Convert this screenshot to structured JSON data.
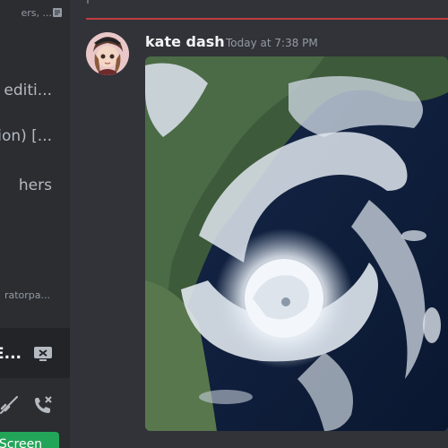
{
  "sidebar": {
    "top_subtext": "ers, ...",
    "doc_icon": "doc-icon",
    "items": [
      {
        "label": "editi..."
      },
      {
        "label": "ion) [..."
      },
      {
        "label": "hers"
      },
      {
        "label": "ratorpa..."
      }
    ],
    "voice_panel": {
      "label": "E...",
      "screen_icon": "screen-share-icon"
    },
    "controls": {
      "mute_icon": "mic-muted-icon",
      "call_icon": "disconnect-call-icon"
    },
    "screen_button": "Screen"
  },
  "message": {
    "username": "kate dash",
    "timestamp": "Today at 7:38 PM",
    "attachment": "hurricane-satellite-image"
  },
  "colors": {
    "background": "#313338",
    "sidebar": "#2b2d31",
    "new_divider": "#c03b42",
    "green": "#23a559"
  }
}
